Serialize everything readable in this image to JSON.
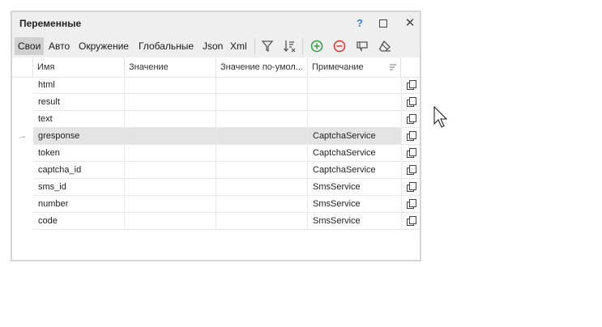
{
  "window": {
    "title": "Переменные",
    "help_label": "?",
    "close_label": "✕"
  },
  "toolbar": {
    "tabs": [
      "Свои",
      "Авто",
      "Окружение",
      "Глобальные",
      "Json",
      "Xml"
    ],
    "active_tab": "Свои",
    "icons": [
      "filter-icon",
      "sort-clear-icon",
      "add-icon",
      "remove-icon",
      "comment-icon",
      "eraser-icon"
    ]
  },
  "table": {
    "columns": [
      "Имя",
      "Значение",
      "Значение по-умол...",
      "Примечание"
    ],
    "current_row_marker": "→",
    "rows": [
      {
        "name": "html",
        "value": "",
        "default": "",
        "note": ""
      },
      {
        "name": "result",
        "value": "",
        "default": "",
        "note": ""
      },
      {
        "name": "text",
        "value": "",
        "default": "",
        "note": ""
      },
      {
        "name": "gresponse",
        "value": "",
        "default": "",
        "note": "CaptchaService",
        "selected": true
      },
      {
        "name": "token",
        "value": "",
        "default": "",
        "note": "CaptchaService"
      },
      {
        "name": "captcha_id",
        "value": "",
        "default": "",
        "note": "CaptchaService"
      },
      {
        "name": "sms_id",
        "value": "",
        "default": "",
        "note": "SmsService"
      },
      {
        "name": "number",
        "value": "",
        "default": "",
        "note": "SmsService"
      },
      {
        "name": "code",
        "value": "",
        "default": "",
        "note": "SmsService"
      }
    ]
  },
  "colors": {
    "accent_add": "#2f9e44",
    "accent_remove": "#e03131",
    "help": "#3b7fd6",
    "selected_row": "#e4e4e4"
  }
}
